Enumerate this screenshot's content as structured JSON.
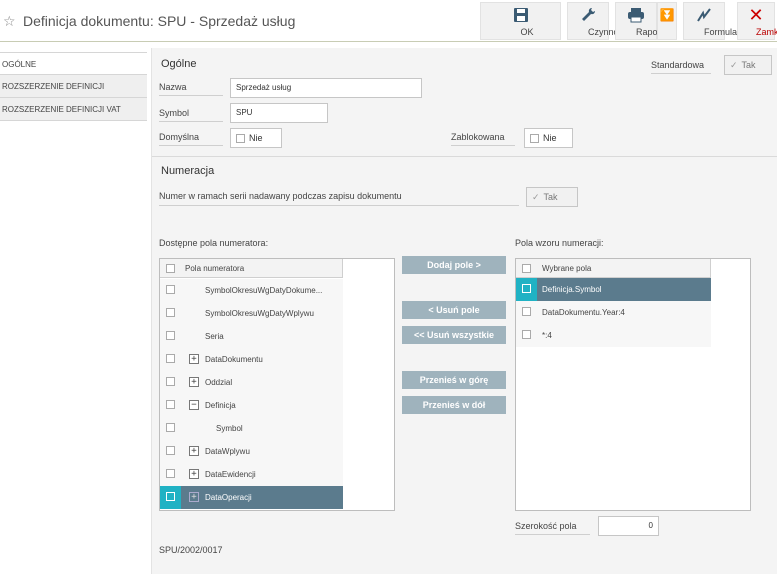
{
  "window": {
    "title": "Definicja dokumentu: SPU - Sprzedaż usług"
  },
  "toolbar": {
    "ok": "OK",
    "actions": "Czynności",
    "reports": "Raporty",
    "form": "Formularz",
    "close": "Zamknij"
  },
  "sidebar": {
    "items": [
      {
        "label": "OGÓLNE"
      },
      {
        "label": "ROZSZERZENIE DEFINICJI"
      },
      {
        "label": "ROZSZERZENIE DEFINICJI VAT"
      }
    ]
  },
  "general": {
    "heading": "Ogólne",
    "standard_label": "Standardowa",
    "standard_value": "Tak",
    "name_label": "Nazwa",
    "name_value": "Sprzedaż usług",
    "symbol_label": "Symbol",
    "symbol_value": "SPU",
    "default_label": "Domyślna",
    "default_value": "Nie",
    "blocked_label": "Zablokowana",
    "blocked_value": "Nie"
  },
  "numbering": {
    "heading": "Numeracja",
    "serial_label": "Numer w ramach serii nadawany podczas zapisu dokumentu",
    "serial_value": "Tak",
    "available_label": "Dostępne pola numeratora:",
    "pattern_label": "Pola wzoru numeracji:",
    "available_header": "Pola numeratora",
    "available_rows": [
      {
        "label": "SymbolOkresuWgDatyDokume...",
        "indent": 0,
        "expander": ""
      },
      {
        "label": "SymbolOkresuWgDatyWplywu",
        "indent": 0,
        "expander": ""
      },
      {
        "label": "Seria",
        "indent": 0,
        "expander": ""
      },
      {
        "label": "DataDokumentu",
        "indent": 0,
        "expander": "+"
      },
      {
        "label": "Oddzial",
        "indent": 0,
        "expander": "+"
      },
      {
        "label": "Definicja",
        "indent": 0,
        "expander": "−"
      },
      {
        "label": "Symbol",
        "indent": 1,
        "expander": ""
      },
      {
        "label": "DataWplywu",
        "indent": 0,
        "expander": "+"
      },
      {
        "label": "DataEwidencji",
        "indent": 0,
        "expander": "+"
      },
      {
        "label": "DataOperacji",
        "indent": 0,
        "expander": "+",
        "selected": true
      }
    ],
    "pattern_header": "Wybrane pola",
    "pattern_rows": [
      {
        "label": "Definicja.Symbol",
        "selected": true
      },
      {
        "label": "DataDokumentu.Year:4"
      },
      {
        "label": "*:4"
      }
    ],
    "buttons": {
      "add": "Dodaj pole >",
      "remove": "< Usuń pole",
      "remove_all": "<< Usuń wszystkie",
      "move_up": "Przenieś w górę",
      "move_down": "Przenieś w dół"
    },
    "width_label": "Szerokość pola",
    "width_value": "0",
    "example": "SPU/2002/0017"
  }
}
